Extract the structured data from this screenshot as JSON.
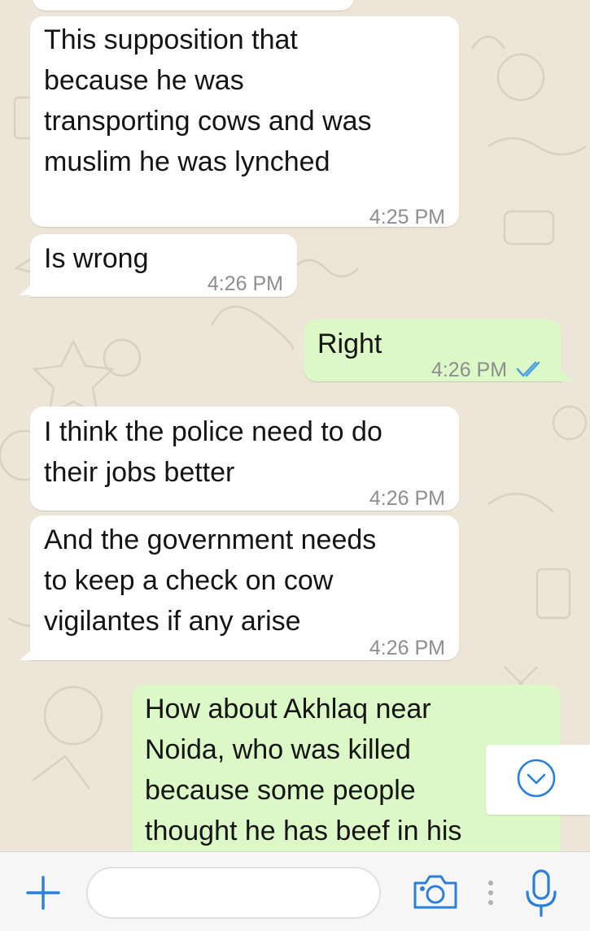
{
  "messages": [
    {
      "direction": "incoming",
      "text": "This supposition that\nbecause he was\ntransporting cows and was\nmuslim he was lynched",
      "time": "4:25 PM"
    },
    {
      "direction": "incoming",
      "text": "Is wrong",
      "time": "4:26 PM"
    },
    {
      "direction": "outgoing",
      "text": "Right",
      "time": "4:26 PM",
      "status": "read"
    },
    {
      "direction": "incoming",
      "text": "I think the police need to do\ntheir jobs better",
      "time": "4:26 PM"
    },
    {
      "direction": "incoming",
      "text": "And the government needs\nto keep a check on cow\nvigilantes if any arise",
      "time": "4:26 PM"
    },
    {
      "direction": "outgoing",
      "text": "How about Akhlaq near\nNoida, who was killed\nbecause some people\nthought he has beef in his",
      "time": ""
    }
  ],
  "toolbar": {
    "compose_value": "",
    "compose_placeholder": "",
    "icons": [
      "plus-icon",
      "camera-icon",
      "more-dots-icon",
      "microphone-icon"
    ]
  },
  "colors": {
    "incoming_bubble": "#ffffff",
    "outgoing_bubble": "#dcf8c6",
    "read_ticks": "#4fa3e0",
    "accent": "#2b7fd8"
  }
}
